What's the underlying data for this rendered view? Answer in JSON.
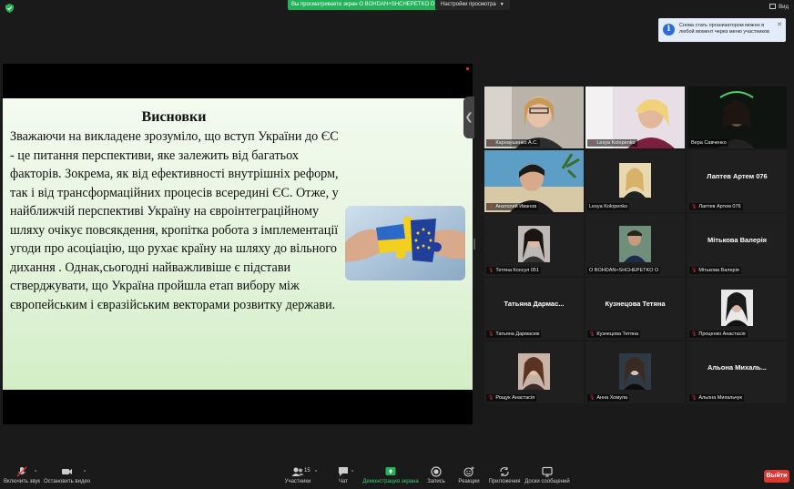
{
  "top_bar": {
    "share_banner": "Вы просматриваете экран О BOHDAN+SHCHEPETKO О",
    "view_options": "Настройки просмотра",
    "view_toggle": "Вид"
  },
  "notification": {
    "message": "Снова стать организатором можно в любой момент через меню участников"
  },
  "slide": {
    "title": "Висновки",
    "body": "Зважаючи на викладене зрозуміло, що вступ України до ЄС - це питання перспективи, яке залежить від багатьох факторів. Зокрема, як від ефективності внутрішніх реформ, так і від трансформаційних процесів всередині ЄС. Отже, у найближчій перспективі Україну на євроінтеграційному шляху очікує повсякдення, кропітка робота з імплементації угоди про асоціацію, що рухає країну на шляху до вільного дихання . Однак,сьогодні найважливіше  є підстави стверджувати, що Україна пройшла етап вибору між європейським і євразійським векторами розвитку держави."
  },
  "participants": [
    {
      "name": "Карнаушенко А.С.",
      "center": "",
      "muted": true
    },
    {
      "name": "Lesya Kolopenko",
      "center": "",
      "muted": true
    },
    {
      "name": "Вера Савченко",
      "center": "",
      "muted": false
    },
    {
      "name": "Анатолий Иванов",
      "center": "",
      "muted": true
    },
    {
      "name": "Lesya Kolopenko",
      "center": "",
      "muted": false
    },
    {
      "name": "Лаптев Артем 076",
      "center": "Лаптев Артем 076",
      "muted": true
    },
    {
      "name": "Тетяна Консул 051",
      "center": "",
      "muted": true
    },
    {
      "name": "О BOHDAN+SHCHEPETKO О",
      "center": "",
      "muted": false
    },
    {
      "name": "Мiтькова Валерiя",
      "center": "Мiтькова Валерiя",
      "muted": true
    },
    {
      "name": "Татьяна Дармасюк",
      "center": "Татьяна  Дармас...",
      "muted": true
    },
    {
      "name": "Кузнецова Тетяна",
      "center": "Кузнецова Тетяна",
      "muted": true
    },
    {
      "name": "Проценко Анастасiя",
      "center": "",
      "muted": true
    },
    {
      "name": "Рощук Анастасiя",
      "center": "",
      "muted": true
    },
    {
      "name": "Анна Хомула",
      "center": "",
      "muted": true
    },
    {
      "name": "Альона Михальчук",
      "center": "Альона  Михаль...",
      "muted": true
    }
  ],
  "toolbar": {
    "audio": "Включить звук",
    "video": "Остановить видео",
    "participants": "Участники",
    "participants_count": "15",
    "chat": "Чат",
    "share": "Демонстрация экрана",
    "record": "Запись",
    "reactions": "Реакции",
    "apps": "Приложения",
    "whiteboard": "Доски сообщений",
    "end": "Выйти"
  },
  "colors": {
    "share_green": "#23b15a",
    "end_red": "#d63a32",
    "active_speaker": "#d6d84a",
    "slide_bg": "#e4f4dd"
  }
}
